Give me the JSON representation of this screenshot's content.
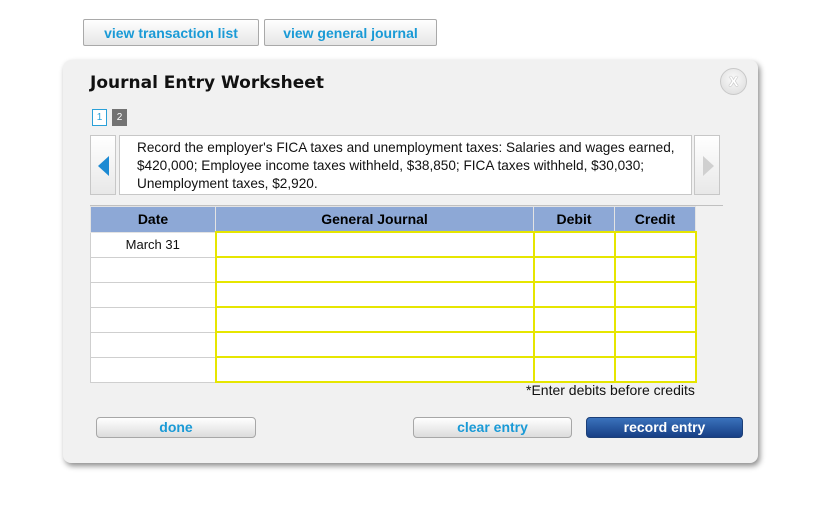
{
  "top_buttons": {
    "view_transaction_list": "view transaction list",
    "view_general_journal": "view general journal"
  },
  "worksheet": {
    "title": "Journal Entry Worksheet",
    "close_label": "X",
    "pages": [
      "1",
      "2"
    ],
    "current_page": "2",
    "description": "Record the employer's FICA taxes and unemployment taxes: Salaries and wages earned, $420,000; Employee income taxes withheld, $38,850; FICA taxes withheld, $30,030; Unemployment taxes, $2,920."
  },
  "table": {
    "headers": {
      "date": "Date",
      "general_journal": "General Journal",
      "debit": "Debit",
      "credit": "Credit"
    },
    "rows": [
      {
        "date": "March 31",
        "account": "",
        "debit": "",
        "credit": ""
      },
      {
        "date": "",
        "account": "",
        "debit": "",
        "credit": ""
      },
      {
        "date": "",
        "account": "",
        "debit": "",
        "credit": ""
      },
      {
        "date": "",
        "account": "",
        "debit": "",
        "credit": ""
      },
      {
        "date": "",
        "account": "",
        "debit": "",
        "credit": ""
      },
      {
        "date": "",
        "account": "",
        "debit": "",
        "credit": ""
      }
    ]
  },
  "note": "*Enter debits before credits",
  "actions": {
    "done": "done",
    "clear_entry": "clear entry",
    "record_entry": "record entry"
  },
  "colors": {
    "link_blue": "#1a9ad6",
    "header_blue": "#8da8d6",
    "input_border_yellow": "#e6e600",
    "primary_button": "#1f4f9a"
  },
  "icons": {
    "prev": "left-arrow-icon",
    "next": "right-arrow-icon",
    "close": "close-icon"
  }
}
